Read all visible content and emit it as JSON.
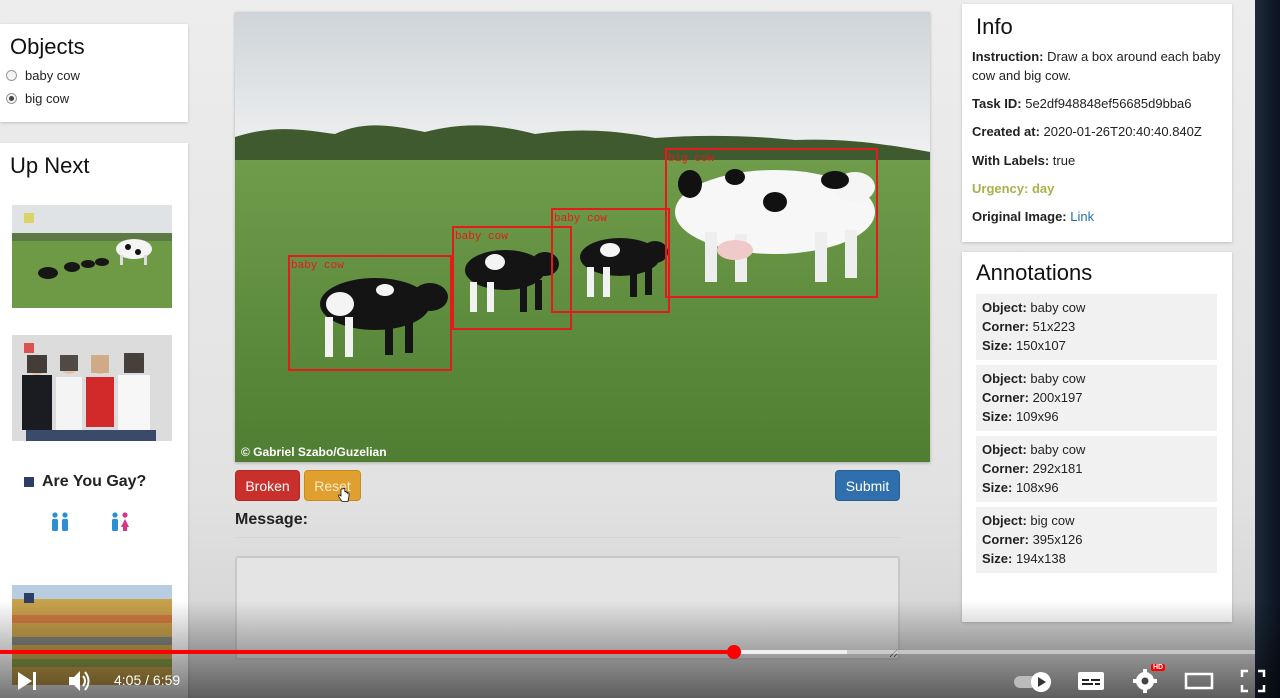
{
  "objects": {
    "title": "Objects",
    "options": [
      {
        "label": "baby cow",
        "checked": false
      },
      {
        "label": "big cow",
        "checked": true
      }
    ]
  },
  "up_next": {
    "title": "Up Next",
    "quiz_title": "Are You Gay?",
    "thumb_marker_colors": [
      "#d9d36a",
      "#d9534f",
      "#2c3e66",
      "#2c3e66"
    ]
  },
  "image": {
    "credit": "© Gabriel Szabo/Guzelian",
    "boxes": [
      {
        "label": "baby cow"
      },
      {
        "label": "baby cow"
      },
      {
        "label": "baby cow"
      },
      {
        "label": "big cow"
      }
    ]
  },
  "buttons": {
    "broken": "Broken",
    "reset": "Reset",
    "submit": "Submit"
  },
  "message": {
    "label": "Message:",
    "value": ""
  },
  "info": {
    "title": "Info",
    "instruction_label": "Instruction:",
    "instruction": " Draw a box around each baby cow and big cow.",
    "task_id_label": "Task ID:",
    "task_id": " 5e2df948848ef56685d9bba6",
    "created_label": "Created at:",
    "created": " 2020-01-26T20:40:40.840Z",
    "with_labels_label": "With Labels:",
    "with_labels": " true",
    "urgency": "Urgency: day",
    "original_label": "Original Image:",
    "original_link": "Link"
  },
  "annotations": {
    "title": "Annotations",
    "object_label": "Object:",
    "corner_label": "Corner:",
    "size_label": "Size:",
    "items": [
      {
        "object": " baby cow",
        "corner": " 51x223",
        "size": " 150x107"
      },
      {
        "object": " baby cow",
        "corner": " 200x197",
        "size": " 109x96"
      },
      {
        "object": " baby cow",
        "corner": " 292x181",
        "size": " 108x96"
      },
      {
        "object": " big cow",
        "corner": " 395x126",
        "size": " 194x138"
      }
    ]
  },
  "player": {
    "time": "4:05 / 6:59",
    "played_fraction": 0.585,
    "buffered_fraction": 0.675,
    "hd_badge": "HD",
    "icons": [
      "play-icon",
      "volume-icon",
      "autoplay-toggle-icon",
      "subtitles-icon",
      "settings-icon",
      "theater-mode-icon",
      "fullscreen-icon"
    ]
  },
  "colors": {
    "box_stroke": "#e41b1b",
    "danger": "#c9302c",
    "warning": "#e0a030",
    "primary": "#2f6fad",
    "urgency": "#aab04a",
    "progress": "#ff0000"
  }
}
